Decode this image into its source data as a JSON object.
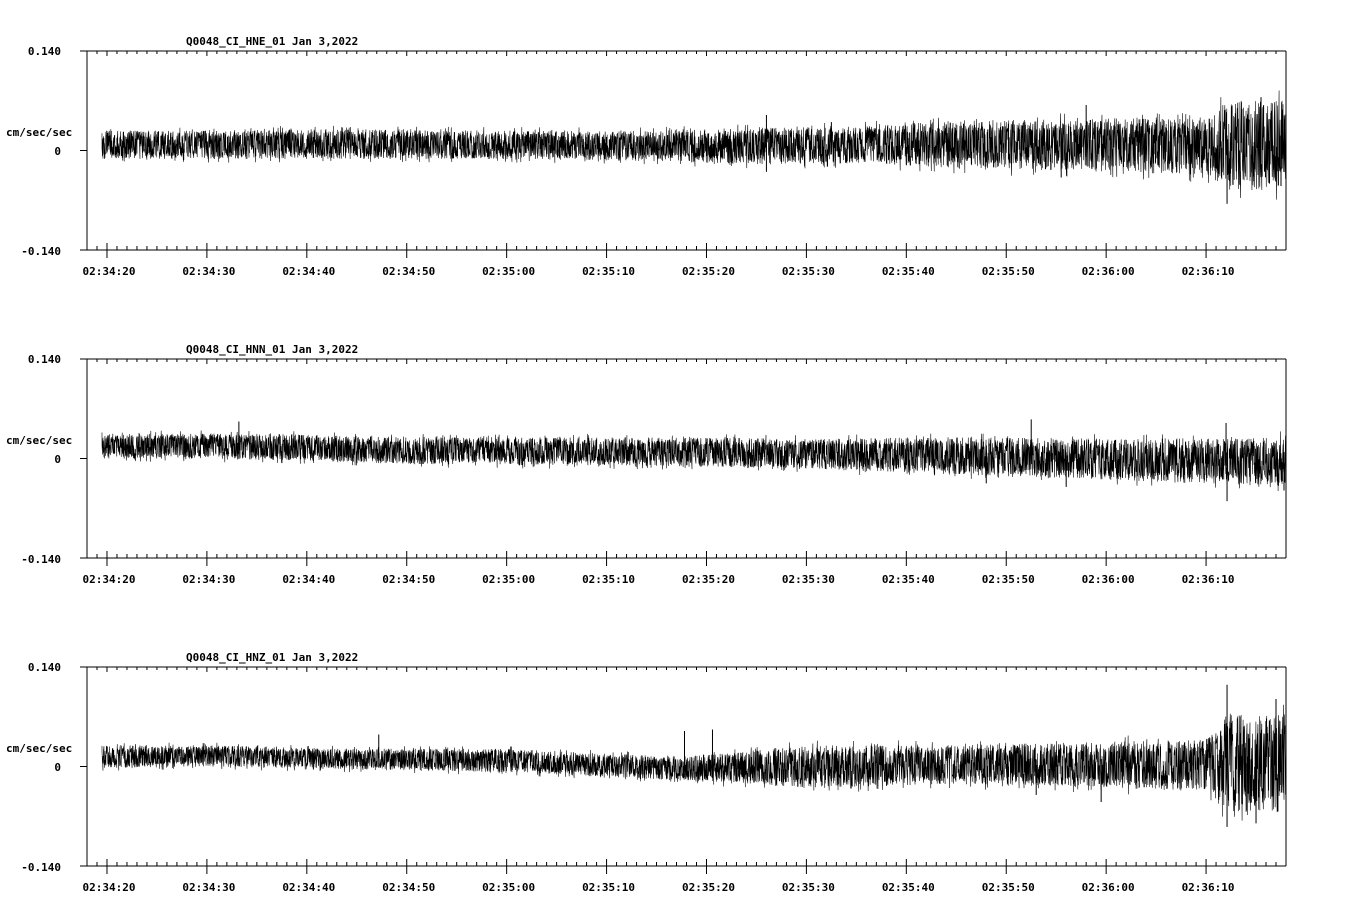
{
  "chart_data": [
    {
      "type": "line",
      "title": "Q0048_CI_HNE_01  Jan 3,2022",
      "ylabel": "cm/sec/sec",
      "ylim": [
        -0.14,
        0.14
      ],
      "y_ticks": [
        "0.140",
        "0",
        "-0.140"
      ],
      "x_ticks": [
        "02:34:20",
        "02:34:30",
        "02:34:40",
        "02:34:50",
        "02:35:00",
        "02:35:10",
        "02:35:20",
        "02:35:30",
        "02:35:40",
        "02:35:50",
        "02:36:00",
        "02:36:10"
      ],
      "xlim_seconds": [
        -2,
        118
      ],
      "signal_start_seconds": -0.5,
      "series": [
        {
          "envelope": [
            {
              "t": 0,
              "lo": -0.012,
              "hi": 0.028
            },
            {
              "t": 20,
              "lo": -0.012,
              "hi": 0.03
            },
            {
              "t": 40,
              "lo": -0.012,
              "hi": 0.028
            },
            {
              "t": 55,
              "lo": -0.015,
              "hi": 0.028
            },
            {
              "t": 65,
              "lo": -0.02,
              "hi": 0.032
            },
            {
              "t": 75,
              "lo": -0.018,
              "hi": 0.034
            },
            {
              "t": 85,
              "lo": -0.025,
              "hi": 0.042
            },
            {
              "t": 100,
              "lo": -0.03,
              "hi": 0.045
            },
            {
              "t": 110,
              "lo": -0.035,
              "hi": 0.045
            },
            {
              "t": 112,
              "lo": -0.055,
              "hi": 0.07
            },
            {
              "t": 118,
              "lo": -0.055,
              "hi": 0.07
            }
          ],
          "spikes": [
            {
              "t": 95.5,
              "v": -0.038
            },
            {
              "t": 98.0,
              "v": 0.064
            },
            {
              "t": 66.0,
              "v": 0.05
            },
            {
              "t": 66.0,
              "v": -0.03
            },
            {
              "t": 112.1,
              "v": -0.075
            },
            {
              "t": 115.5,
              "v": 0.075
            },
            {
              "t": 117.5,
              "v": -0.05
            },
            {
              "t": 72.5,
              "v": 0.04
            }
          ]
        }
      ]
    },
    {
      "type": "line",
      "title": "Q0048_CI_HNN_01  Jan 3,2022",
      "ylabel": "cm/sec/sec",
      "ylim": [
        -0.14,
        0.14
      ],
      "y_ticks": [
        "0.140",
        "0",
        "-0.140"
      ],
      "x_ticks": [
        "02:34:20",
        "02:34:30",
        "02:34:40",
        "02:34:50",
        "02:35:00",
        "02:35:10",
        "02:35:20",
        "02:35:30",
        "02:35:40",
        "02:35:50",
        "02:36:00",
        "02:36:10"
      ],
      "xlim_seconds": [
        -2,
        118
      ],
      "signal_start_seconds": -0.5,
      "series": [
        {
          "envelope": [
            {
              "t": 0,
              "lo": 0.0,
              "hi": 0.035
            },
            {
              "t": 15,
              "lo": -0.002,
              "hi": 0.035
            },
            {
              "t": 30,
              "lo": -0.008,
              "hi": 0.03
            },
            {
              "t": 50,
              "lo": -0.01,
              "hi": 0.03
            },
            {
              "t": 70,
              "lo": -0.015,
              "hi": 0.028
            },
            {
              "t": 85,
              "lo": -0.022,
              "hi": 0.03
            },
            {
              "t": 100,
              "lo": -0.03,
              "hi": 0.028
            },
            {
              "t": 110,
              "lo": -0.035,
              "hi": 0.028
            },
            {
              "t": 118,
              "lo": -0.04,
              "hi": 0.03
            }
          ],
          "spikes": [
            {
              "t": 13.2,
              "v": 0.052
            },
            {
              "t": 92.5,
              "v": 0.055
            },
            {
              "t": 112.1,
              "v": -0.06
            },
            {
              "t": 112.0,
              "v": 0.05
            },
            {
              "t": 117.8,
              "v": -0.045
            },
            {
              "t": 88.0,
              "v": -0.035
            },
            {
              "t": 96.0,
              "v": -0.04
            }
          ]
        }
      ]
    },
    {
      "type": "line",
      "title": "Q0048_CI_HNZ_01  Jan 3,2022",
      "ylabel": "cm/sec/sec",
      "ylim": [
        -0.14,
        0.14
      ],
      "y_ticks": [
        "0.140",
        "0",
        "-0.140"
      ],
      "x_ticks": [
        "02:34:20",
        "02:34:30",
        "02:34:40",
        "02:34:50",
        "02:35:00",
        "02:35:10",
        "02:35:20",
        "02:35:30",
        "02:35:40",
        "02:35:50",
        "02:36:00",
        "02:36:10"
      ],
      "xlim_seconds": [
        -2,
        118
      ],
      "signal_start_seconds": -0.5,
      "series": [
        {
          "envelope": [
            {
              "t": 0,
              "lo": -0.002,
              "hi": 0.03
            },
            {
              "t": 10,
              "lo": 0.0,
              "hi": 0.03
            },
            {
              "t": 25,
              "lo": -0.005,
              "hi": 0.025
            },
            {
              "t": 40,
              "lo": -0.008,
              "hi": 0.025
            },
            {
              "t": 50,
              "lo": -0.015,
              "hi": 0.018
            },
            {
              "t": 58,
              "lo": -0.02,
              "hi": 0.015
            },
            {
              "t": 70,
              "lo": -0.03,
              "hi": 0.03
            },
            {
              "t": 85,
              "lo": -0.025,
              "hi": 0.03
            },
            {
              "t": 100,
              "lo": -0.03,
              "hi": 0.035
            },
            {
              "t": 110,
              "lo": -0.035,
              "hi": 0.038
            },
            {
              "t": 112,
              "lo": -0.065,
              "hi": 0.075
            },
            {
              "t": 118,
              "lo": -0.065,
              "hi": 0.075
            }
          ],
          "spikes": [
            {
              "t": 112.1,
              "v": 0.115
            },
            {
              "t": 112.1,
              "v": -0.085
            },
            {
              "t": 115.0,
              "v": -0.08
            },
            {
              "t": 117.0,
              "v": 0.095
            },
            {
              "t": 57.8,
              "v": 0.05
            },
            {
              "t": 60.6,
              "v": 0.052
            },
            {
              "t": 99.5,
              "v": -0.05
            },
            {
              "t": 27.2,
              "v": 0.045
            },
            {
              "t": 93.0,
              "v": -0.04
            }
          ]
        }
      ]
    }
  ]
}
